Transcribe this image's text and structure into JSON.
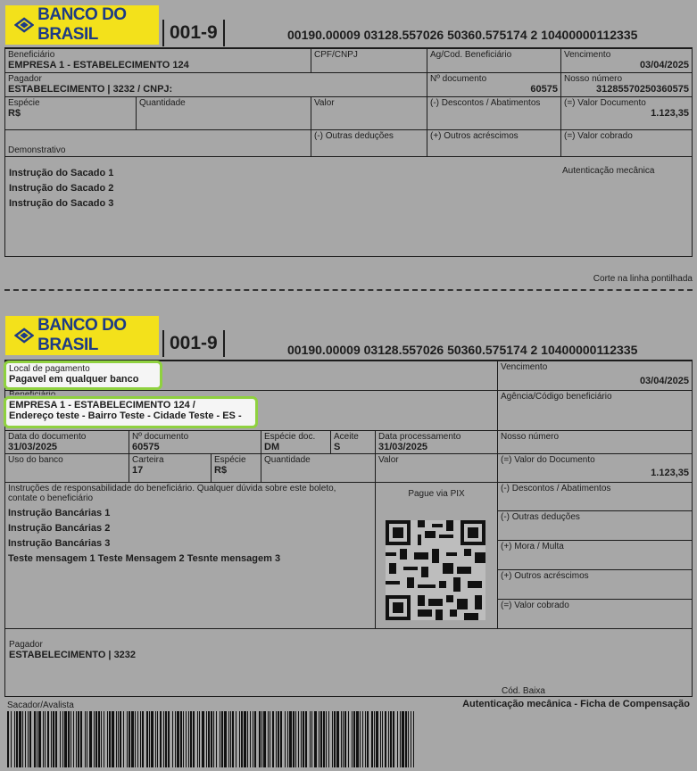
{
  "bank": {
    "name": "BANCO DO BRASIL",
    "code": "001-9",
    "digitable_line": "00190.00009 03128.557026 50360.575174 2 10400000112335"
  },
  "receipt": {
    "beneficiario": {
      "label": "Beneficiário",
      "value": "EMPRESA 1 - ESTABELECIMENTO 124"
    },
    "cpf_cnpj": {
      "label": "CPF/CNPJ",
      "value": ""
    },
    "agencia": {
      "label": "Ag/Cod. Beneficiário",
      "value": ""
    },
    "vencimento": {
      "label": "Vencimento",
      "value": "03/04/2025"
    },
    "pagador": {
      "label": "Pagador",
      "value": "ESTABELECIMENTO | 3232 / CNPJ:"
    },
    "num_doc": {
      "label": "Nº documento",
      "value": "60575"
    },
    "nosso_num": {
      "label": "Nosso número",
      "value": "31285570250360575"
    },
    "especie": {
      "label": "Espécie",
      "value": "R$"
    },
    "quantidade": {
      "label": "Quantidade"
    },
    "valor": {
      "label": "Valor"
    },
    "descontos": {
      "label": "(-) Descontos / Abatimentos"
    },
    "valor_doc": {
      "label": "(=) Valor Documento",
      "value": "1.123,35"
    },
    "demonstrativo": {
      "label": "Demonstrativo"
    },
    "outras_deducoes": {
      "label": "(-) Outras deduções"
    },
    "outros_acrescimos": {
      "label": "(+) Outros acréscimos"
    },
    "valor_cobrado": {
      "label": "(=) Valor cobrado"
    },
    "instrucoes": [
      "Instrução do Sacado 1",
      "Instrução do Sacado 2",
      "Instrução do Sacado 3"
    ],
    "autenticacao": "Autenticação mecânica"
  },
  "cut_line": "Corte na linha pontilhada",
  "slip": {
    "local_pagamento": {
      "label": "Local de pagamento",
      "value": "Pagavel em qualquer banco"
    },
    "vencimento": {
      "label": "Vencimento",
      "value": "03/04/2025"
    },
    "beneficiario": {
      "label": "Beneficiário",
      "value": "EMPRESA 1 - ESTABELECIMENTO 124 /",
      "address": "Endereço teste - Bairro Teste - Cidade Teste - ES -"
    },
    "agencia": {
      "label": "Agência/Código beneficiário"
    },
    "data_doc": {
      "label": "Data do documento",
      "value": "31/03/2025"
    },
    "num_doc": {
      "label": "Nº documento",
      "value": "60575"
    },
    "especie_doc": {
      "label": "Espécie doc.",
      "value": "DM"
    },
    "aceite": {
      "label": "Aceite",
      "value": "S"
    },
    "data_proc": {
      "label": "Data processamento",
      "value": "31/03/2025"
    },
    "nosso_num": {
      "label": "Nosso número"
    },
    "uso_banco": {
      "label": "Uso do banco"
    },
    "carteira": {
      "label": "Carteira",
      "value": "17"
    },
    "especie": {
      "label": "Espécie",
      "value": "R$"
    },
    "quantidade": {
      "label": "Quantidade"
    },
    "valor": {
      "label": "Valor"
    },
    "valor_doc": {
      "label": "(=) Valor do Documento",
      "value": "1.123,35"
    },
    "instrucoes_label": "Instruções de responsabilidade do beneficiário. Qualquer dúvida sobre este boleto, contate o beneficiário",
    "instrucoes": [
      "Instrução Bancárias 1",
      "Instrução Bancárias 2",
      "Instrução Bancárias 3",
      "Teste mensagem 1 Teste Mensagem 2 Tesnte mensagem 3"
    ],
    "pix": "Pague via PIX",
    "descontos": "(-) Descontos / Abatimentos",
    "outras_deducoes": "(-) Outras deduções",
    "mora": "(+) Mora / Multa",
    "outros_acrescimos": "(+) Outros acréscimos",
    "valor_cobrado": "(=) Valor cobrado",
    "pagador": {
      "label": "Pagador",
      "value": "ESTABELECIMENTO | 3232"
    },
    "cod_baixa": "Cód. Baixa",
    "sacador": "Sacador/Avalista",
    "autenticacao": "Autenticação mecânica - Ficha de Compensação"
  },
  "colors": {
    "background": "#a7a7a7",
    "logo_bg": "#f3e11b",
    "logo_text": "#1d3b86",
    "highlight": "#8fd13f"
  }
}
